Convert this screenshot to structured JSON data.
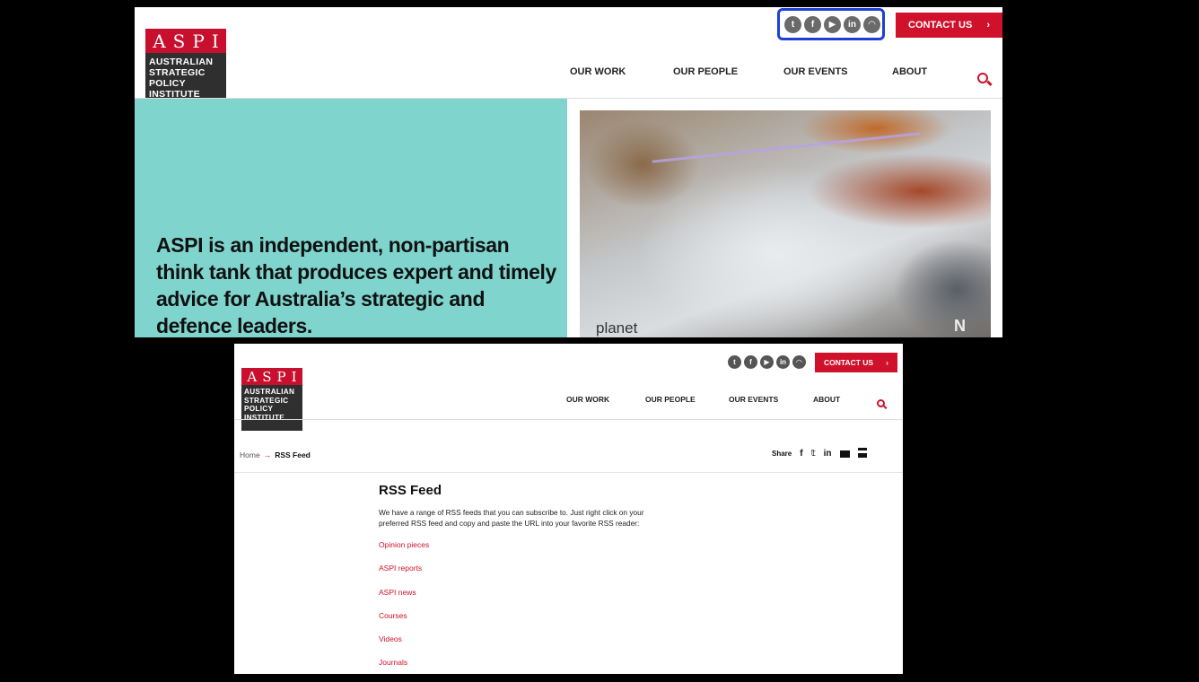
{
  "logo": {
    "abbrev": "ASPI",
    "line1": "AUSTRALIAN",
    "line2": "STRATEGIC",
    "line3": "POLICY",
    "line4": "INSTITUTE"
  },
  "social_icons": [
    {
      "name": "twitter-icon",
      "glyph": "t"
    },
    {
      "name": "facebook-icon",
      "glyph": "f"
    },
    {
      "name": "youtube-icon",
      "glyph": "▶"
    },
    {
      "name": "linkedin-icon",
      "glyph": "in"
    },
    {
      "name": "rss-icon",
      "glyph": "◠"
    }
  ],
  "header": {
    "contact_label": "CONTACT US",
    "contact_arrow": "›",
    "nav": [
      "OUR WORK",
      "OUR PEOPLE",
      "OUR EVENTS",
      "ABOUT"
    ]
  },
  "hero": {
    "text": "ASPI is an independent, non-partisan think tank that produces expert and timely advice for Australia’s strategic and defence leaders.",
    "map_label": "planet",
    "map_north": "N"
  },
  "rss_page": {
    "breadcrumb_home": "Home",
    "breadcrumb_arrow": "→",
    "breadcrumb_current": "RSS Feed",
    "share_label": "Share",
    "share_icons": [
      "f",
      "𝕥",
      "in"
    ],
    "title": "RSS Feed",
    "description": "We have a range of RSS feeds that you can subscribe to. Just right click on your preferred RSS feed and copy and paste the URL into your favorite RSS reader:",
    "feeds": [
      "Opinion pieces",
      "ASPI reports",
      "ASPI news",
      "Courses",
      "Videos",
      "Journals"
    ]
  },
  "colors": {
    "brand_red": "#d0112b",
    "hero_teal": "#7fd5ce",
    "highlight_blue": "#1e3fd6"
  }
}
